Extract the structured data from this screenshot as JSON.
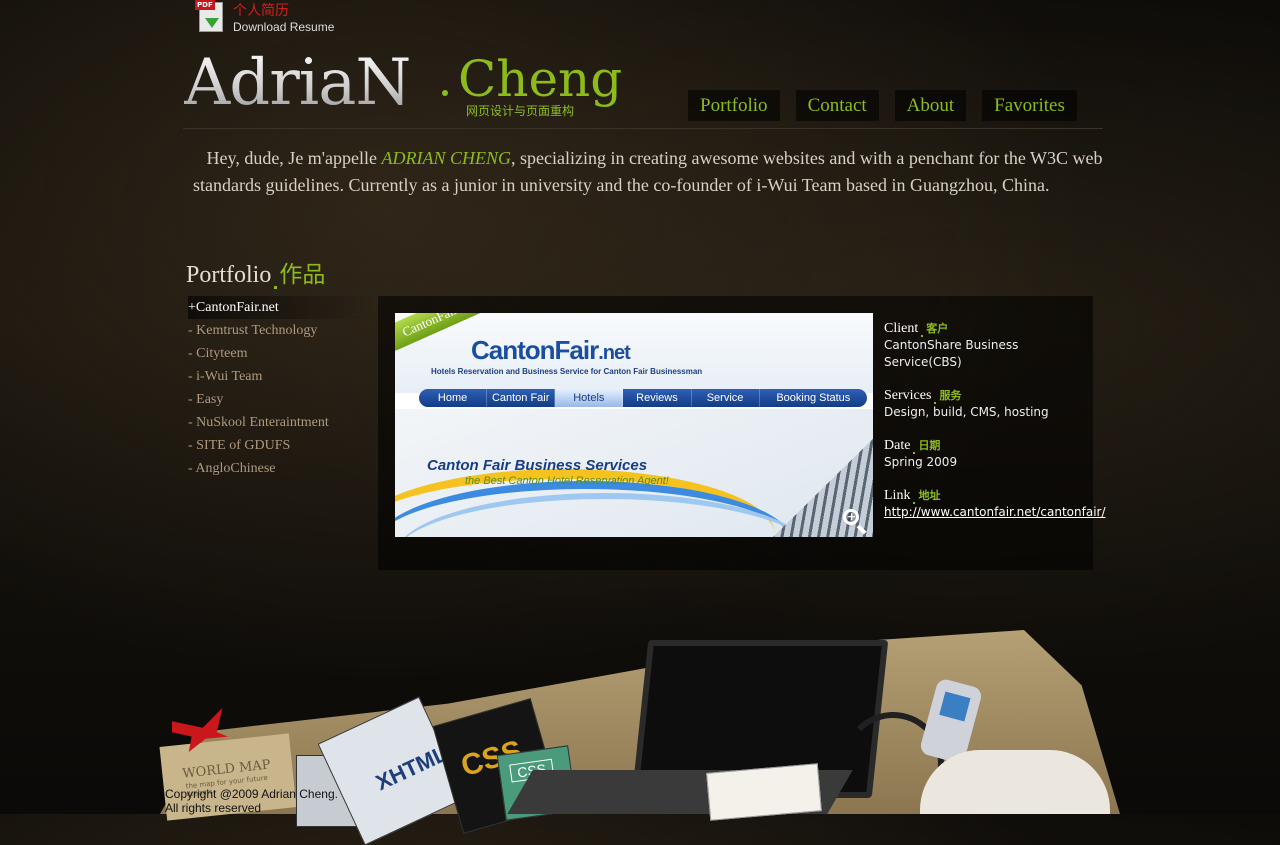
{
  "resume": {
    "label_cn": "个人简历",
    "label_en": "Download Resume",
    "pdf_tag": "PDF"
  },
  "logo": {
    "name": "AdriaN",
    "surname": "Cheng",
    "subtitle": "网页设计与页面重构"
  },
  "nav": [
    "Portfolio",
    "Contact",
    "About",
    "Favorites"
  ],
  "intro": {
    "before": "Hey, dude, Je m'appelle ",
    "name": "ADRIAN CHENG",
    "after": ", specializing in creating awesome websites and with a penchant for the W3C web standards guidelines. Currently as a junior in university and the co-founder of  i-Wui Team based in Guangzhou, China."
  },
  "portfolio": {
    "title": "Portfolio",
    "title_cn": "作品",
    "projects": [
      "+CantonFair.net",
      "- Kemtrust Technology",
      "- Cityteem",
      "- i-Wui Team",
      "- Easy",
      "- NuSkool Enteraintment",
      "- SITE of GDUFS",
      "- AngloChinese"
    ],
    "active_index": 0
  },
  "screenshot": {
    "ribbon": "CantonFair.net",
    "logo_main": "CantonFair",
    "logo_suffix": ".net",
    "tagline": "Hotels Reservation and Business Service for Canton Fair Businessman",
    "nav": [
      "Home",
      "Canton Fair",
      "Hotels",
      "Reviews",
      "Service",
      "Booking Status"
    ],
    "nav_active": "Hotels",
    "headline": "Canton Fair Business Services",
    "subheadline": "the Best Canton Hotel Reservation Agent!"
  },
  "details": {
    "client": {
      "label": "Client",
      "label_cn": "客户",
      "value": "CantonShare Business Service(CBS)"
    },
    "services": {
      "label": "Services",
      "label_cn": "服务",
      "value": "Design, build, CMS, hosting"
    },
    "date": {
      "label": "Date",
      "label_cn": "日期",
      "value": "Spring 2009"
    },
    "link": {
      "label": "Link",
      "label_cn": "地址",
      "value": "http://www.cantonfair.net/cantonfair/"
    }
  },
  "collage": {
    "map_title": "WORLD MAP",
    "map_subtitle": "the map for your future dreams",
    "book_xhtml": "XHTML",
    "book_css_pro": "CSS",
    "book_css": "CSS"
  },
  "footer": {
    "copyright": "Copyright @2009 Adrian Cheng.",
    "rights": "All rights reserved"
  },
  "colors": {
    "accent": "#8dbb1b",
    "background": "#14110c",
    "resume_red": "#d41e1e",
    "link_list": "#b09a7e"
  }
}
